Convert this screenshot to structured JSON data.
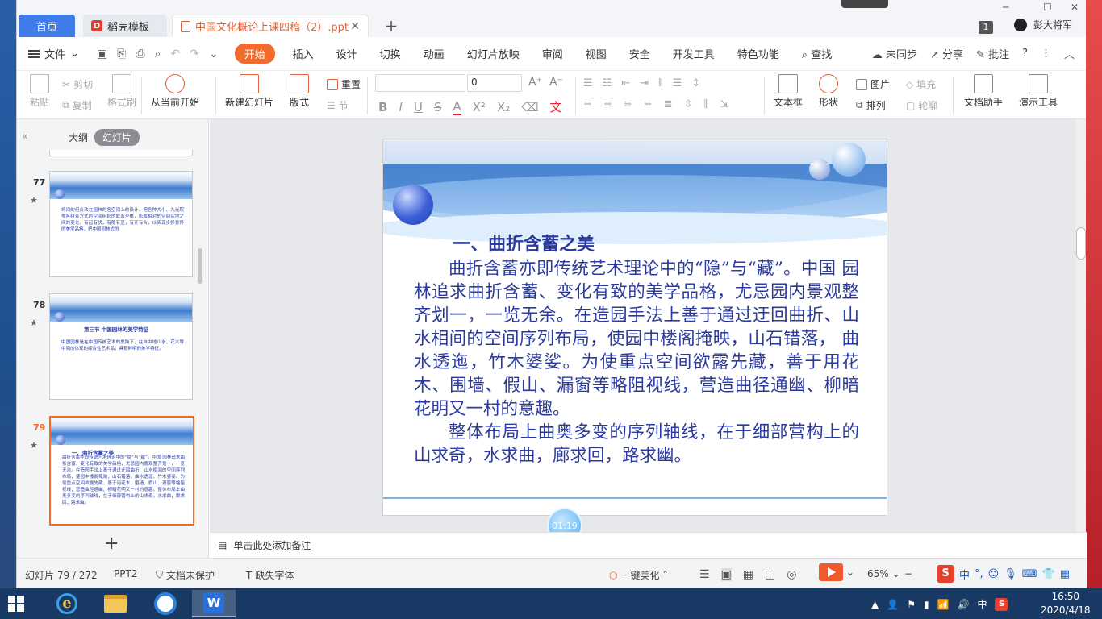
{
  "titlebar": {
    "tab_home": "首页",
    "tab_daoke": "稻壳模板",
    "tab_doc": "中国文化概论上课四稿（2）.ppt",
    "tab_close": "✕",
    "tab_new": "+",
    "badge": "1",
    "user": "彭大将军",
    "min": "─",
    "max": "☐",
    "close": "✕"
  },
  "menubar": {
    "file": "文件",
    "items": [
      "开始",
      "插入",
      "设计",
      "切换",
      "动画",
      "幻灯片放映",
      "审阅",
      "视图",
      "安全",
      "开发工具",
      "特色功能"
    ],
    "search": "查找",
    "sync": "未同步",
    "share": "分享",
    "comment": "批注",
    "help": "?"
  },
  "ribbon": {
    "paste": "粘贴",
    "cut": "剪切",
    "copy": "复制",
    "format_painter": "格式刷",
    "from_current": "从当前开始",
    "new_slide": "新建幻灯片",
    "layout": "版式",
    "reset": "重置",
    "section": "节",
    "font_name": "",
    "font_size": "0",
    "picture": "图片",
    "fill": "填充",
    "textbox": "文本框",
    "shape": "形状",
    "arrange": "排列",
    "outline": "轮廓",
    "doc_helper": "文档助手",
    "present_tools": "演示工具"
  },
  "leftpanel": {
    "tab_outline": "大纲",
    "tab_slides": "幻灯片",
    "thumbs": [
      {
        "num": "77",
        "title": "",
        "text": "将间的组合法在园林的各空间上的设计，把各种大小、九光院等各组合方式的空间组织的联系全体，形成相对的空间实地之间的变化，有起有伏，有隐有显，有开有合，以实现步移景异的美学品格，把中国园林式的"
      },
      {
        "num": "78",
        "title": "第三节  中国园林的美学特征",
        "text": "中国园林是在中国传统艺术的熏陶下，在自由地山水、花木等中间的体现的综合性艺术品，具有鲜明的美学特征。"
      },
      {
        "num": "79",
        "title": "一、曲折含蓄之美",
        "text": "曲折含蓄亦即传统艺术理论中的“隐”与“藏”。中国 园林追求曲折含蓄、变化有致的美学品格，尤忌园内景观整齐划一，一览无余。在造园手法上善于通过迂回曲折、山水相间的空间序列布局，使园中楼阁掩映，山石错落，曲水透迤，竹木婆娑。为使重点空间欲露先藏，善于用花木、围墙、假山、漏窗等略阻视线，营造曲径通幽、柳暗花明又一村的意趣。整体布局上曲奥多变的序列轴线，在于细部营构上的山求奇，水求曲，廊求回，路求幽。"
      }
    ],
    "add": "+"
  },
  "slide": {
    "title": "一、曲折含蓄之美",
    "para1": "曲折含蓄亦即传统艺术理论中的“隐”与“藏”。中国 园林追求曲折含蓄、变化有致的美学品格，尤忌园内景观整齐划一，一览无余。在造园手法上善于通过迂回曲折、山水相间的空间序列布局，使园中楼阁掩映，山石错落， 曲水透迤，竹木婆娑。为使重点空间欲露先藏，善于用花木、围墙、假山、漏窗等略阻视线，营造曲径通幽、柳暗花明又一村的意趣。",
    "para2": "整体布局上曲奥多变的序列轴线，在于细部营构上的山求奇，水求曲，廊求回，路求幽。",
    "timer": "01:19"
  },
  "notes": {
    "placeholder": "单击此处添加备注"
  },
  "statusbar": {
    "slide_counter": "幻灯片 79 / 272",
    "theme": "PPT2",
    "doc_protect": "文档未保护",
    "missing_font": "缺失字体",
    "beautify": "一键美化",
    "zoom": "65%",
    "ime_zh": "中"
  },
  "taskbar": {
    "time": "16:50",
    "date": "2020/4/18",
    "tray_ime": "中"
  },
  "colors": {
    "accent_orange": "#f06c2d",
    "home_tab_blue": "#3f7ce8",
    "slide_text_blue": "#2b3a9e"
  }
}
